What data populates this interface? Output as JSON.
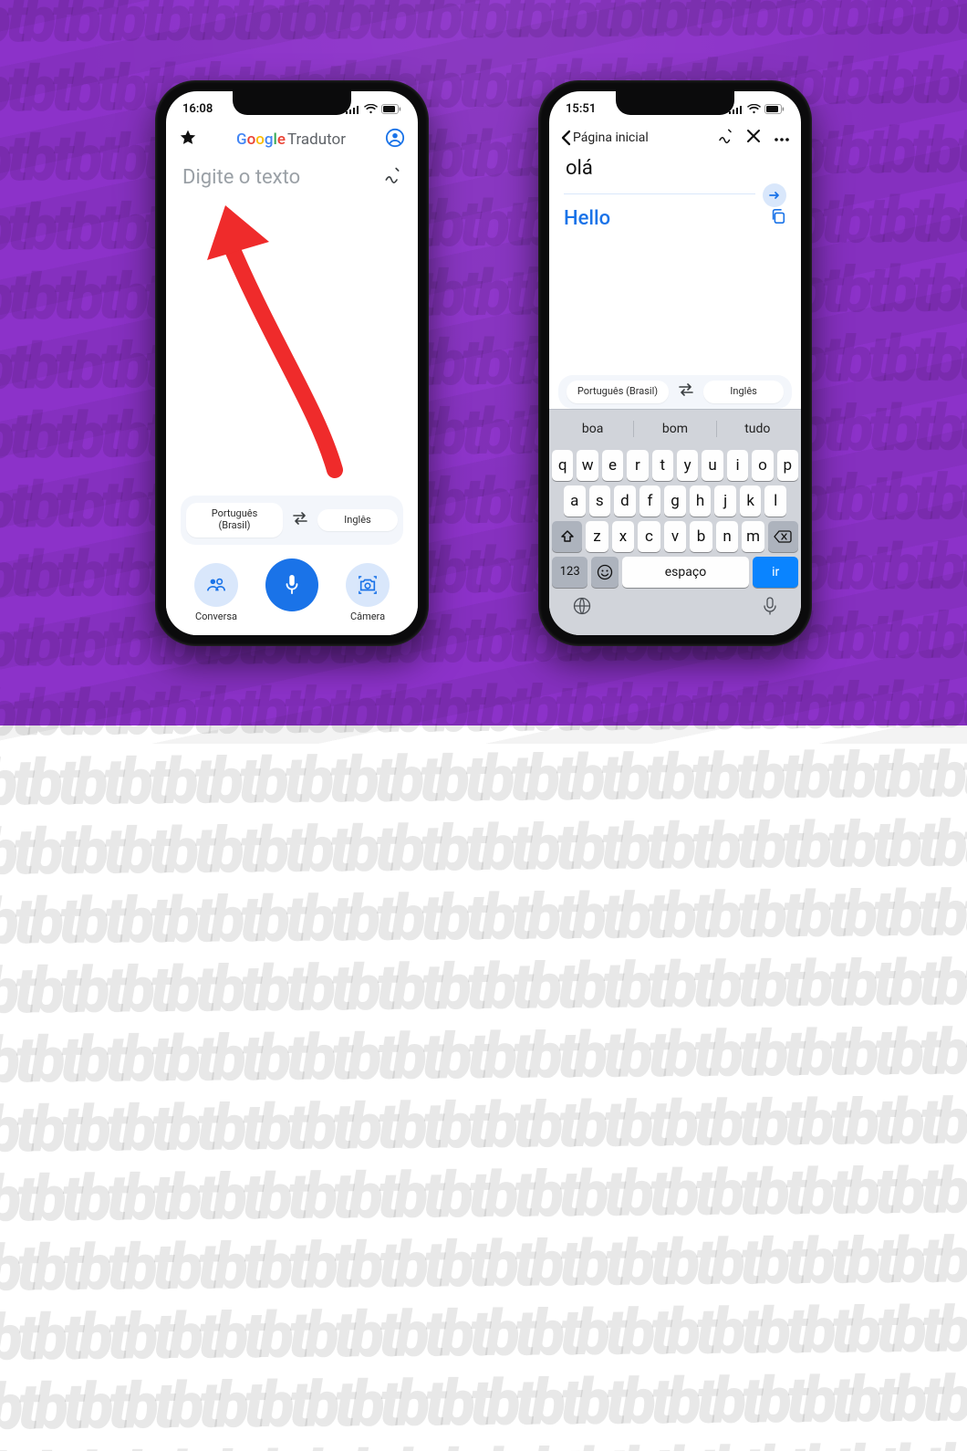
{
  "background": {
    "pattern_text": "tb",
    "accent": "#8c32c9"
  },
  "phone1": {
    "status_time": "16:08",
    "app_title_brand": "Google",
    "app_title_rest": "Tradutor",
    "input_placeholder": "Digite o texto",
    "lang_from": "Português (Brasil)",
    "lang_to": "Inglês",
    "btn_conversation": "Conversa",
    "btn_camera": "Câmera"
  },
  "phone2": {
    "status_time": "15:51",
    "back_label": "Página inicial",
    "source_text": "olá",
    "translated_text": "Hello",
    "lang_from": "Português (Brasil)",
    "lang_to": "Inglês",
    "suggestions": [
      "boa",
      "bom",
      "tudo"
    ],
    "kb_rows": [
      [
        "q",
        "w",
        "e",
        "r",
        "t",
        "y",
        "u",
        "i",
        "o",
        "p"
      ],
      [
        "a",
        "s",
        "d",
        "f",
        "g",
        "h",
        "j",
        "k",
        "l"
      ],
      [
        "z",
        "x",
        "c",
        "v",
        "b",
        "n",
        "m"
      ]
    ],
    "key_numbers": "123",
    "key_space": "espaço",
    "key_go": "ir"
  }
}
